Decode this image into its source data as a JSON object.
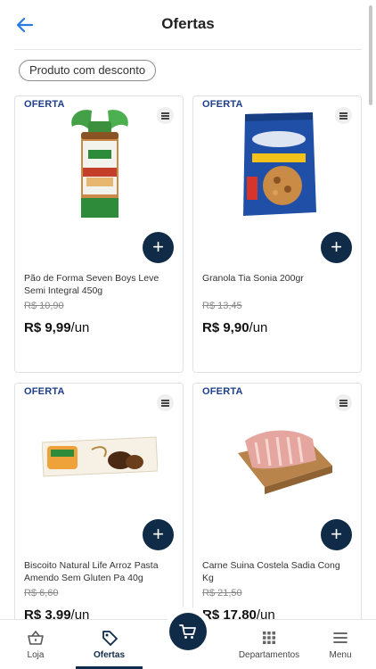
{
  "header": {
    "title": "Ofertas"
  },
  "filters": {
    "chip_label": "Produto com desconto"
  },
  "products": [
    {
      "badge": "OFERTA",
      "name": "Pão de Forma Seven Boys Leve Semi Integral 450g",
      "old_price": "R$ 10,90",
      "price": "R$ 9,99",
      "unit": "/un"
    },
    {
      "badge": "OFERTA",
      "name": "Granola Tia Sonia 200gr",
      "old_price": "R$ 13,45",
      "price": "R$ 9,90",
      "unit": "/un"
    },
    {
      "badge": "OFERTA",
      "name": "Biscoito Natural Life Arroz Pasta Amendo Sem Gluten Pa 40g",
      "old_price": "R$ 6,60",
      "price": "R$ 3,99",
      "unit": "/un"
    },
    {
      "badge": "OFERTA",
      "name": "Carne Suina Costela Sadia Cong Kg",
      "old_price": "R$ 21,50",
      "price": "R$ 17,80",
      "unit": "/un"
    }
  ],
  "bottom_nav": {
    "items": [
      {
        "label": "Loja"
      },
      {
        "label": "Ofertas"
      },
      {
        "label": "Departamentos"
      },
      {
        "label": "Menu"
      }
    ]
  },
  "colors": {
    "primary": "#0f2b47",
    "badge": "#1d3f8c",
    "back_arrow": "#2a7ae2"
  }
}
